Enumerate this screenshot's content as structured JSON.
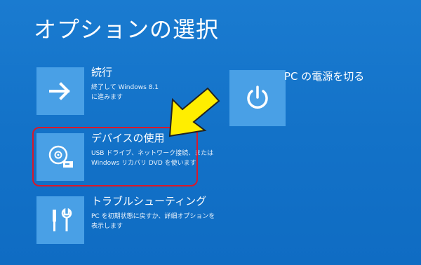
{
  "screen": {
    "title": "オプションの選択"
  },
  "options": {
    "continue": {
      "title": "続行",
      "desc_line1": "終了して Windows 8.1",
      "desc_line2": "に進みます",
      "icon": "arrow-right-icon"
    },
    "device": {
      "title": "デバイスの使用",
      "desc_line1": "USB ドライブ、ネットワーク接続、または",
      "desc_line2": "Windows リカバリ DVD を使います",
      "icon": "disc-drive-icon"
    },
    "troubleshoot": {
      "title": "トラブルシューティング",
      "desc_line1": "PC を初期状態に戻すか、詳細オプションを",
      "desc_line2": "表示します",
      "icon": "tools-icon"
    },
    "power_off": {
      "title": "PC の電源を切る",
      "icon": "power-icon"
    }
  },
  "annotations": {
    "highlight_color": "#d8182a",
    "pointer_arrow_color": "#ffee00"
  },
  "colors": {
    "background": "#1473c8",
    "tile": "#49a0e6",
    "text": "#ffffff"
  }
}
